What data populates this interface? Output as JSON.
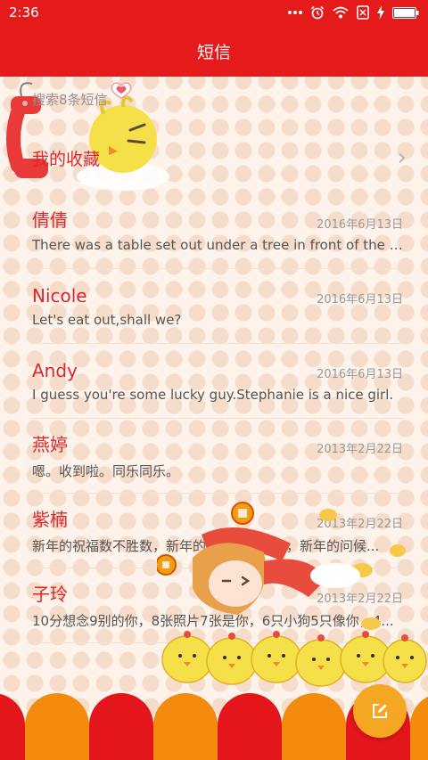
{
  "status_bar": {
    "time": "2:36",
    "icons": [
      "more-dots-icon",
      "alarm-icon",
      "wifi-icon",
      "no-sim-icon",
      "charging-icon",
      "battery-icon"
    ]
  },
  "header": {
    "title": "短信"
  },
  "search": {
    "placeholder": "搜索8条短信"
  },
  "favorites": {
    "label": "我的收藏",
    "chevron": "›"
  },
  "threads": [
    {
      "name": "倩倩",
      "date": "2016年6月13日",
      "snippet": "There was a table set out under a tree in front of the ho..."
    },
    {
      "name": "Nicole",
      "date": "2016年6月13日",
      "snippet": "Let's eat out,shall we?"
    },
    {
      "name": "Andy",
      "date": "2016年6月13日",
      "snippet": "I guess you're some lucky guy.Stephanie is a nice girl."
    },
    {
      "name": "燕婷",
      "date": "2013年2月22日",
      "snippet": "嗯。收到啦。同乐同乐。"
    },
    {
      "name": "紫楠",
      "date": "2013年2月22日",
      "snippet": "新年的祝福数不胜数，新年的愿望好多好多，新年的问候..."
    },
    {
      "name": "子玲",
      "date": "2013年2月22日",
      "snippet": "10分想念9别的你，8张照片7张是你，6只小狗5只像你，4..."
    }
  ],
  "fab": {
    "icon": "compose-icon"
  },
  "colors": {
    "header_red": "#e51a1a",
    "name_red": "#e0262b",
    "fab_orange": "#f5a623",
    "scallop_red": "#e3161b",
    "scallop_orange": "#f38b0e"
  }
}
